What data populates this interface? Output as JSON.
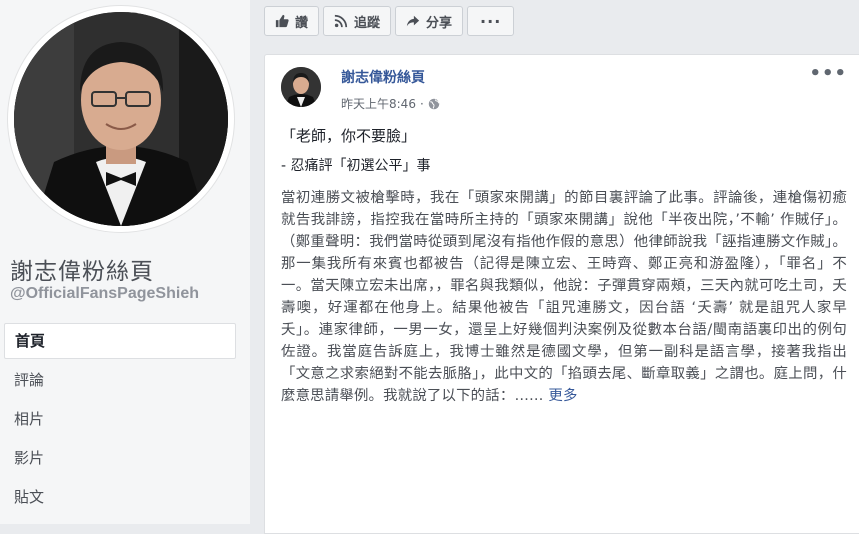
{
  "page": {
    "name": "謝志偉粉絲頁",
    "handle": "@OfficialFansPageShieh"
  },
  "nav": {
    "items": [
      {
        "label": "首頁",
        "active": true
      },
      {
        "label": "評論",
        "active": false
      },
      {
        "label": "相片",
        "active": false
      },
      {
        "label": "影片",
        "active": false
      },
      {
        "label": "貼文",
        "active": false
      }
    ]
  },
  "actions": {
    "like": "讚",
    "follow": "追蹤",
    "share": "分享",
    "more": "···"
  },
  "post": {
    "author": "謝志偉粉絲頁",
    "time": "昨天上午8:46",
    "audience_icon": "globe-icon",
    "menu": "•••",
    "line1": "「老師，你不要臉」",
    "line2": "- 忍痛評「初選公平」事",
    "paragraph": "當初連勝文被槍擊時，我在「頭家來開講」的節目裏評論了此事。評論後，連槍傷初癒就告我誹謗，指控我在當時所主持的「頭家來開講」說他「半夜出院，’不輸’ 作賊仔」。（鄭重聲明：我們當時從頭到尾沒有指他作假的意思）他律師說我「誣指連勝文作賊」。那一集我所有來賓也都被告（記得是陳立宏、王時齊、鄭正亮和游盈隆），「罪名」不一。當天陳立宏未出席，，罪名與我類似，他說：子彈貫穿兩頰，三天內就可吃土司，夭壽噢，好運都在他身上。結果他被告「詛咒連勝文，因台語 ‘夭壽’ 就是詛咒人家早夭」。連家律師，一男一女，還呈上好幾個判決案例及從數本台語/閩南語裏印出的例句佐證。我當庭告訴庭上，我博士雖然是德國文學，但第一副科是語言學，接著我指出「文意之求索絕對不能去脈胳」，此中文的「掐頭去尾、斷章取義」之謂也。庭上問，什麼意思請舉例。我就說了以下的話：……",
    "see_more": "更多"
  },
  "colors": {
    "background": "#e9ebee",
    "link": "#365899",
    "text": "#1d2129"
  }
}
